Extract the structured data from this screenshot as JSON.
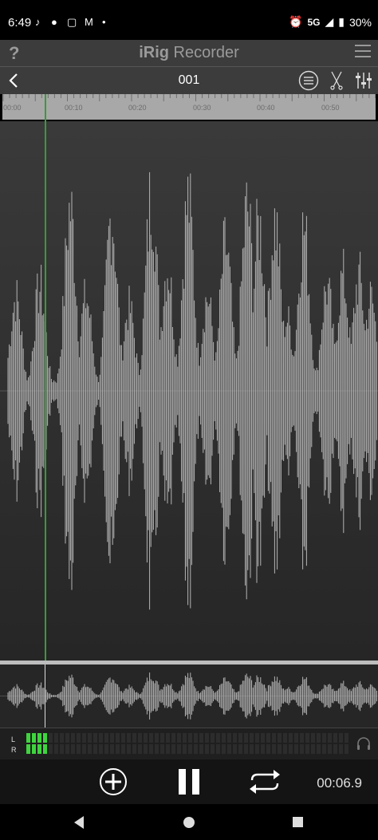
{
  "status_bar": {
    "time": "6:49",
    "network": "5G",
    "battery": "30%"
  },
  "app_bar": {
    "help_label": "?",
    "title_bold": "iRig",
    "title_rest": " Recorder"
  },
  "file_bar": {
    "file_name": "001"
  },
  "ruler": {
    "ticks": [
      "00:00",
      "00:10",
      "00:20",
      "00:30",
      "00:40",
      "00:50"
    ]
  },
  "meter": {
    "left_label": "L",
    "right_label": "R",
    "active_segments": 4
  },
  "transport": {
    "elapsed": "00:06.9"
  },
  "colors": {
    "playhead": "#3a9a3a",
    "meter_on": "#3fd43f",
    "wave": "#b4b4b4"
  }
}
